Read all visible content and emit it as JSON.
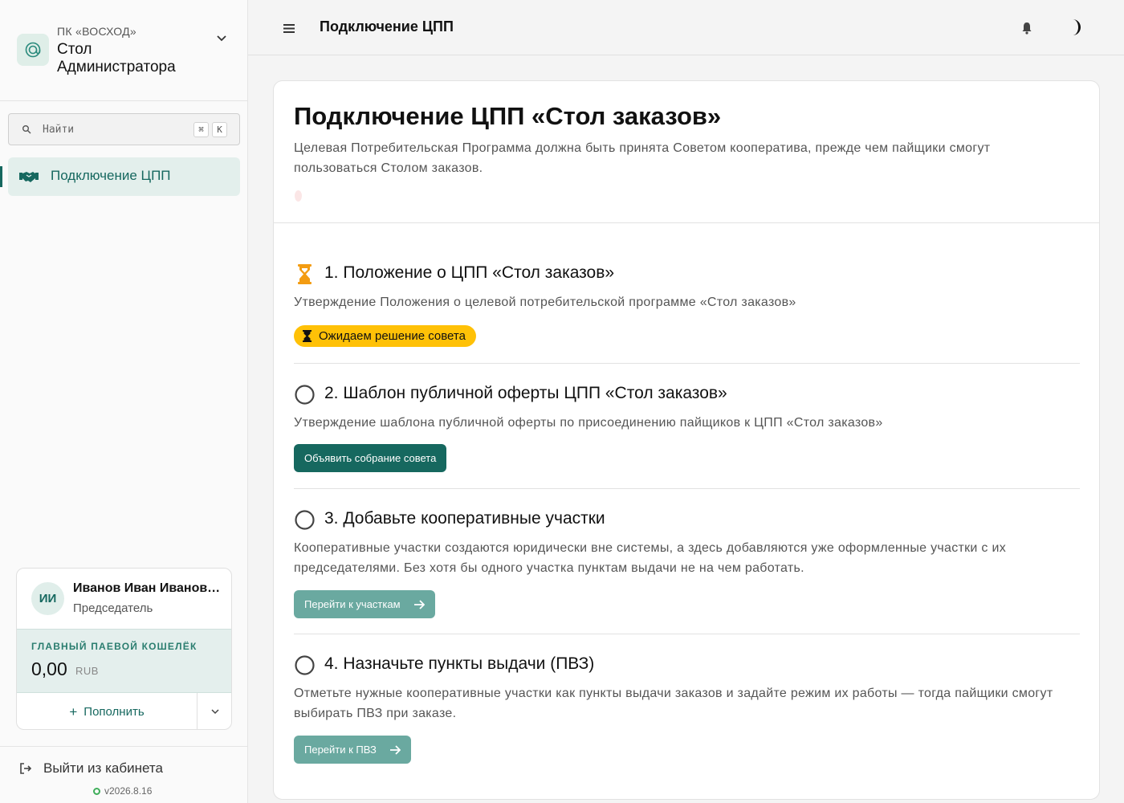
{
  "sidebar": {
    "org": "ПК «ВОСХОД»",
    "title": "Стол Администратора",
    "search": {
      "placeholder": "Найти",
      "shortcut_mod": "⌘",
      "shortcut_key": "K"
    },
    "nav": [
      {
        "label": "Подключение ЦПП",
        "icon": "handshake-icon",
        "active": true
      }
    ],
    "user": {
      "initials": "ИИ",
      "name": "Иванов Иван Иванович",
      "role": "Председатель",
      "wallet_label": "ГЛАВНЫЙ ПАЕВОЙ КОШЕЛЁК",
      "wallet_amount": "0,00",
      "wallet_currency": "RUB",
      "topup_label": "Пополнить"
    },
    "logout_label": "Выйти из кабинета",
    "version": "v2026.8.16"
  },
  "header": {
    "title": "Подключение ЦПП"
  },
  "main": {
    "title": "Подключение ЦПП «Стол заказов»",
    "description": "Целевая Потребительская Программа должна быть принята Советом кооператива, прежде чем пайщики смогут пользоваться Столом заказов.",
    "steps": [
      {
        "title": "1. Положение о ЦПП «Стол заказов»",
        "description": "Утверждение Положения о целевой потребительской программе «Стол заказов»",
        "status": "pending",
        "badge": "Ожидаем решение совета"
      },
      {
        "title": "2. Шаблон публичной оферты ЦПП «Стол заказов»",
        "description": "Утверждение шаблона публичной оферты по присоединению пайщиков к ЦПП «Стол заказов»",
        "status": "todo",
        "action": "Объявить собрание совета"
      },
      {
        "title": "3. Добавьте кооперативные участки",
        "description": "Кооперативные участки создаются юридически вне системы, а здесь добавляются уже оформленные участки с их председателями. Без хотя бы одного участка пунктам выдачи не на чем работать.",
        "status": "todo",
        "action": "Перейти к участкам"
      },
      {
        "title": "4. Назначьте пункты выдачи (ПВЗ)",
        "description": "Отметьте нужные кооперативные участки как пункты выдачи заказов и задайте режим их работы — тогда пайщики смогут выбирать ПВЗ при заказе.",
        "status": "todo",
        "action": "Перейти к ПВЗ"
      }
    ]
  },
  "colors": {
    "accent": "#16685f",
    "accent_muted": "#6aa9a0",
    "warning": "#ffc107",
    "pending_icon": "#f39c12"
  }
}
